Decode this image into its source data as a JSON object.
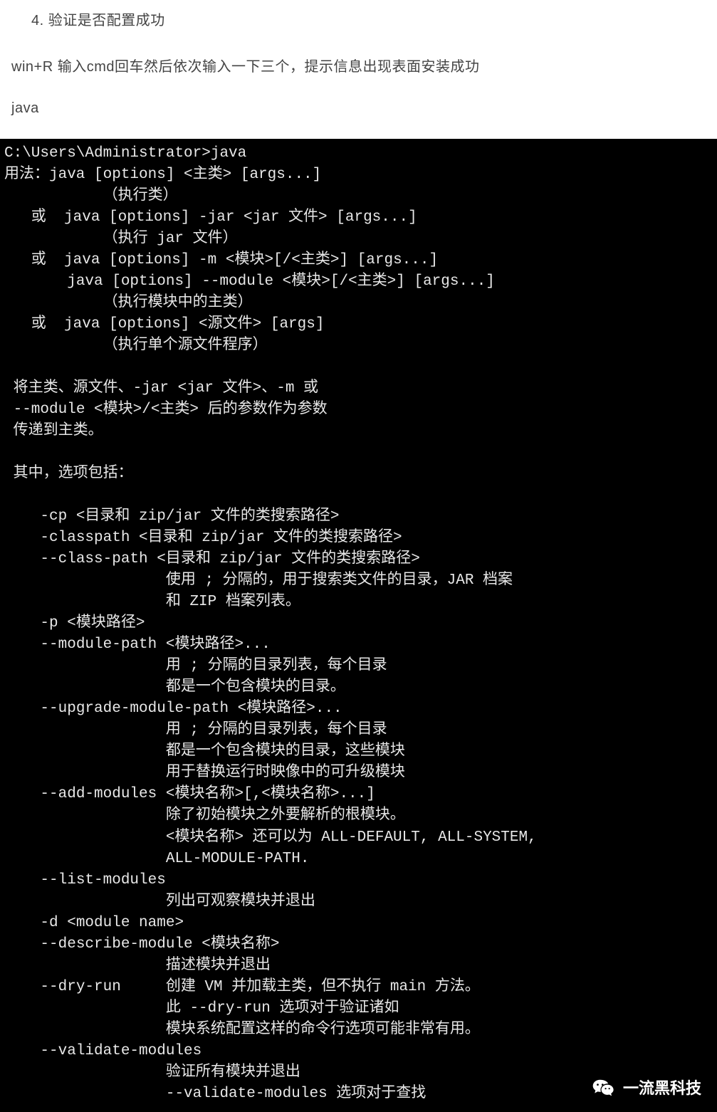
{
  "article": {
    "list_item": "4. 验证是否配置成功",
    "p1": "win+R 输入cmd回车然后依次输入一下三个，提示信息出现表面安装成功",
    "p2": "java"
  },
  "terminal": {
    "lines": [
      "C:\\Users\\Administrator>java",
      "用法：java [options] <主类> [args...]",
      "           （执行类）",
      "   或  java [options] -jar <jar 文件> [args...]",
      "           （执行 jar 文件）",
      "   或  java [options] -m <模块>[/<主类>] [args...]",
      "       java [options] --module <模块>[/<主类>] [args...]",
      "           （执行模块中的主类）",
      "   或  java [options] <源文件> [args]",
      "           （执行单个源文件程序）",
      "",
      " 将主类、源文件、-jar <jar 文件>、-m 或",
      " --module <模块>/<主类> 后的参数作为参数",
      " 传递到主类。",
      "",
      " 其中，选项包括：",
      "",
      "    -cp <目录和 zip/jar 文件的类搜索路径>",
      "    -classpath <目录和 zip/jar 文件的类搜索路径>",
      "    --class-path <目录和 zip/jar 文件的类搜索路径>",
      "                  使用 ; 分隔的，用于搜索类文件的目录，JAR 档案",
      "                  和 ZIP 档案列表。",
      "    -p <模块路径>",
      "    --module-path <模块路径>...",
      "                  用 ; 分隔的目录列表，每个目录",
      "                  都是一个包含模块的目录。",
      "    --upgrade-module-path <模块路径>...",
      "                  用 ; 分隔的目录列表，每个目录",
      "                  都是一个包含模块的目录，这些模块",
      "                  用于替换运行时映像中的可升级模块",
      "    --add-modules <模块名称>[,<模块名称>...]",
      "                  除了初始模块之外要解析的根模块。",
      "                  <模块名称> 还可以为 ALL-DEFAULT, ALL-SYSTEM,",
      "                  ALL-MODULE-PATH.",
      "    --list-modules",
      "                  列出可观察模块并退出",
      "    -d <module name>",
      "    --describe-module <模块名称>",
      "                  描述模块并退出",
      "    --dry-run     创建 VM 并加载主类，但不执行 main 方法。",
      "                  此 --dry-run 选项对于验证诸如",
      "                  模块系统配置这样的命令行选项可能非常有用。",
      "    --validate-modules",
      "                  验证所有模块并退出",
      "                  --validate-modules 选项对于查找"
    ]
  },
  "watermark": {
    "label": "一流黑科技",
    "icon_name": "wechat-icon"
  }
}
